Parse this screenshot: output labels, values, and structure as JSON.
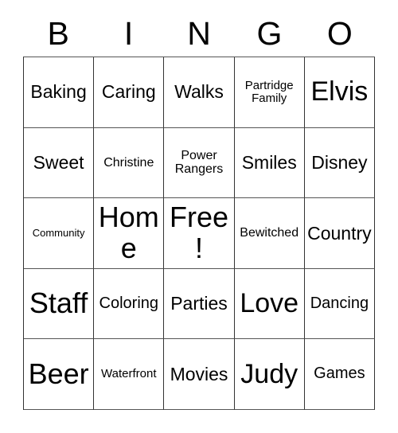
{
  "header": {
    "letters": [
      "B",
      "I",
      "N",
      "G",
      "O"
    ]
  },
  "colors": {
    "background": "#ffffff",
    "text": "#000000",
    "grid_line": "#333333",
    "grid_line_light": "#555555"
  },
  "grid": {
    "columns": 5,
    "rows": 5,
    "free_space_index": 12,
    "cells": [
      {
        "label": "Baking",
        "size": "md"
      },
      {
        "label": "Caring",
        "size": "md"
      },
      {
        "label": "Walks",
        "size": "md"
      },
      {
        "label": "Partridge Family",
        "size": "xxs"
      },
      {
        "label": "Elvis",
        "size": "lg"
      },
      {
        "label": "Sweet",
        "size": "md"
      },
      {
        "label": "Christine",
        "size": "xs"
      },
      {
        "label": "Power Rangers",
        "size": "xs"
      },
      {
        "label": "Smiles",
        "size": "md"
      },
      {
        "label": "Disney",
        "size": "md"
      },
      {
        "label": "Community",
        "size": "tiny"
      },
      {
        "label": "Home",
        "size": "xl"
      },
      {
        "label": "Free!",
        "size": "xl"
      },
      {
        "label": "Bewitched",
        "size": "xs"
      },
      {
        "label": "Country",
        "size": "md"
      },
      {
        "label": "Staff",
        "size": "xl"
      },
      {
        "label": "Coloring",
        "size": "sm"
      },
      {
        "label": "Parties",
        "size": "md"
      },
      {
        "label": "Love",
        "size": "lg"
      },
      {
        "label": "Dancing",
        "size": "sm"
      },
      {
        "label": "Beer",
        "size": "xl"
      },
      {
        "label": "Waterfront",
        "size": "xxs"
      },
      {
        "label": "Movies",
        "size": "md"
      },
      {
        "label": "Judy",
        "size": "lg"
      },
      {
        "label": "Games",
        "size": "sm"
      }
    ]
  }
}
